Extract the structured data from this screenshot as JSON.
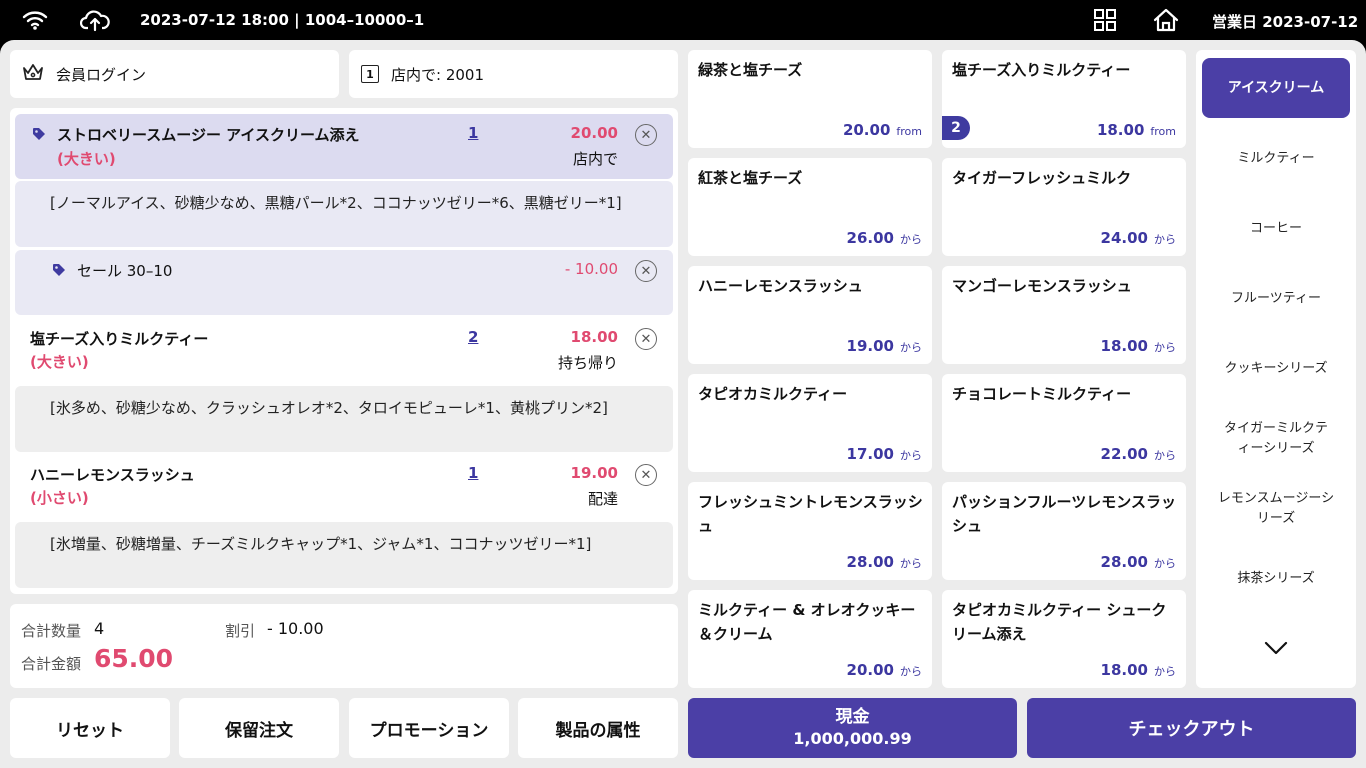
{
  "status_bar": {
    "datetime_terminal": "2023-07-12 18:00 | 1004–10000–1",
    "business_day": "営業日 2023-07-12",
    "icons": [
      "wifi-icon",
      "cloud-upload-icon",
      "grid-icon",
      "home-icon"
    ]
  },
  "member": {
    "label": "会員ログイン",
    "icon": "crown-icon"
  },
  "table": {
    "label": "店内で:  2001",
    "icon": "table-number-icon",
    "icon_text": "1"
  },
  "orders": [
    {
      "name": "ストロベリースムージー アイスクリーム添え",
      "size": "(大きい)",
      "qty": "1",
      "price": "20.00",
      "mode": "店内で",
      "options": "[ノーマルアイス、砂糖少なめ、黒糖パール*2、ココナッツゼリー*6、黒糖ゼリー*1]",
      "discount": {
        "label": "セール 30–10",
        "amount": "- 10.00"
      }
    },
    {
      "name": "塩チーズ入りミルクティー",
      "size": "(大きい)",
      "qty": "2",
      "price": "18.00",
      "mode": "持ち帰り",
      "options": "[氷多め、砂糖少なめ、クラッシュオレオ*2、タロイモピューレ*1、黄桃プリン*2]"
    },
    {
      "name": "ハニーレモンスラッシュ",
      "size": "(小さい)",
      "qty": "1",
      "price": "19.00",
      "mode": "配達",
      "options": "[氷増量、砂糖増量、チーズミルクキャップ*1、ジャム*1、ココナッツゼリー*1]"
    }
  ],
  "totals": {
    "qty_label": "合計数量",
    "qty_value": "4",
    "discount_label": "割引",
    "discount_value": "- 10.00",
    "amount_label": "合計金額",
    "amount_value": "65.00"
  },
  "bottom_buttons": {
    "reset": "リセット",
    "hold": "保留注文",
    "promotion": "プロモーション",
    "attributes": "製品の属性"
  },
  "cash": {
    "label": "現金",
    "amount": "1,000,000.99"
  },
  "checkout": {
    "label": "チェックアウト"
  },
  "products": [
    {
      "name": "緑茶と塩チーズ",
      "price": "20.00",
      "suffix": "from"
    },
    {
      "name": "塩チーズ入りミルクティー",
      "price": "18.00",
      "suffix": "from",
      "badge": "2"
    },
    {
      "name": "紅茶と塩チーズ",
      "price": "26.00",
      "suffix": "から"
    },
    {
      "name": "タイガーフレッシュミルク",
      "price": "24.00",
      "suffix": "から"
    },
    {
      "name": "ハニーレモンスラッシュ",
      "price": "19.00",
      "suffix": "から"
    },
    {
      "name": "マンゴーレモンスラッシュ",
      "price": "18.00",
      "suffix": "から"
    },
    {
      "name": "タピオカミルクティー",
      "price": "17.00",
      "suffix": "から"
    },
    {
      "name": "チョコレートミルクティー",
      "price": "22.00",
      "suffix": "から"
    },
    {
      "name": "フレッシュミントレモンスラッシュ",
      "price": "28.00",
      "suffix": "から"
    },
    {
      "name": "パッションフルーツレモンスラッシュ",
      "price": "28.00",
      "suffix": "から"
    },
    {
      "name": "ミルクティー & オレオクッキー＆クリーム",
      "price": "20.00",
      "suffix": "から"
    },
    {
      "name": "タピオカミルクティー シュークリーム添え",
      "price": "18.00",
      "suffix": "から"
    }
  ],
  "categories": {
    "active": "アイスクリーム",
    "items": [
      "ミルクティー",
      "コーヒー",
      "フルーツティー",
      "クッキーシリーズ",
      "タイガーミルクティーシリーズ",
      "レモンスムージーシリーズ",
      "抹茶シリーズ"
    ],
    "more_icon": "chevron-down-icon"
  },
  "colors": {
    "accent": "#4b3fa6",
    "price_red": "#e04a70",
    "highlight": "#dcdbf0"
  }
}
